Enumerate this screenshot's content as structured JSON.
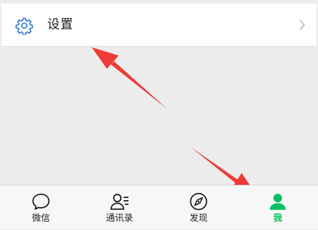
{
  "settings_row": {
    "label": "设置",
    "icon": "gear-icon"
  },
  "tabbar": {
    "tabs": [
      {
        "label": "微信",
        "icon": "chat-bubble-icon"
      },
      {
        "label": "通讯录",
        "icon": "contacts-icon"
      },
      {
        "label": "发现",
        "icon": "compass-icon"
      },
      {
        "label": "我",
        "icon": "person-icon"
      }
    ],
    "active_color": "#07c160"
  },
  "colors": {
    "annotation_arrow": "#ee3b36",
    "accent": "#07c160"
  }
}
